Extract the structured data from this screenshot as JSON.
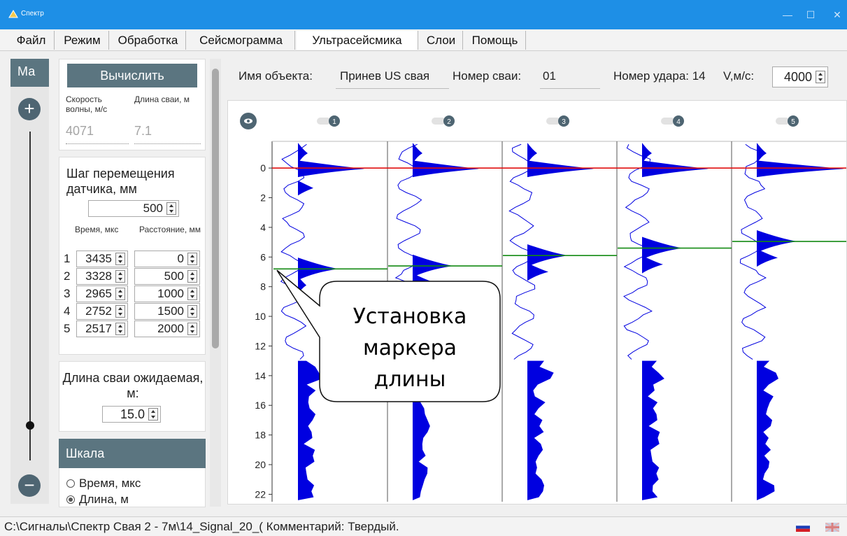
{
  "window": {
    "title": "Спектр"
  },
  "menu": [
    "Файл",
    "Режим",
    "Обработка",
    "Сейсмограмма",
    "Ультрасейсмика",
    "Слои",
    "Помощь"
  ],
  "rail": {
    "label": "Ма",
    "plus": "+",
    "minus": "−"
  },
  "calc": {
    "button": "Вычислить",
    "speed_label": "Скорость волны, м/с",
    "length_label": "Длина сваи, м",
    "speed_value": "4071",
    "length_value": "7.1"
  },
  "step": {
    "title": "Шаг перемещения датчика, мм",
    "value": "500",
    "col_time": "Время, мкс",
    "col_dist": "Расстояние, мм",
    "rows": [
      {
        "n": "1",
        "time": "3435",
        "dist": "0"
      },
      {
        "n": "2",
        "time": "3328",
        "dist": "500"
      },
      {
        "n": "3",
        "time": "2965",
        "dist": "1000"
      },
      {
        "n": "4",
        "time": "2752",
        "dist": "1500"
      },
      {
        "n": "5",
        "time": "2517",
        "dist": "2000"
      }
    ]
  },
  "expected": {
    "title": "Длина сваи ожидаемая, м:",
    "value": "15.0"
  },
  "scale": {
    "title": "Шкала",
    "opt_time": "Время, мкс",
    "opt_length": "Длина, м",
    "selected": "length"
  },
  "header": {
    "object_label": "Имя объекта:",
    "object_value": "Принев US свая",
    "pile_label": "Номер сваи:",
    "pile_value": "01",
    "hit": "Номер удара: 14",
    "v_label": "V,м/с:",
    "v_value": "4000"
  },
  "callout": {
    "text": [
      "Установка",
      "маркера",
      "длины"
    ]
  },
  "status": {
    "path": "C:\\Сигналы\\Спектр Свая 2 - 7м\\14_Signal_20_( Комментарий: Твердый."
  },
  "colors": {
    "accent": "#1e8fe6",
    "header_bg": "#5b7580",
    "trace": "#0000e0",
    "zero_line": "#e01010",
    "marker_line": "#138a13"
  },
  "chart_data": {
    "type": "line",
    "y_ticks": [
      0,
      2,
      4,
      6,
      8,
      10,
      12,
      14,
      16,
      18,
      20,
      22
    ],
    "ylim": [
      -1.8,
      22.5
    ],
    "channels": [
      "1",
      "2",
      "3",
      "4",
      "5"
    ],
    "zero_line": 0,
    "marker_values": [
      6.8,
      6.6,
      5.9,
      5.4,
      4.95
    ]
  }
}
